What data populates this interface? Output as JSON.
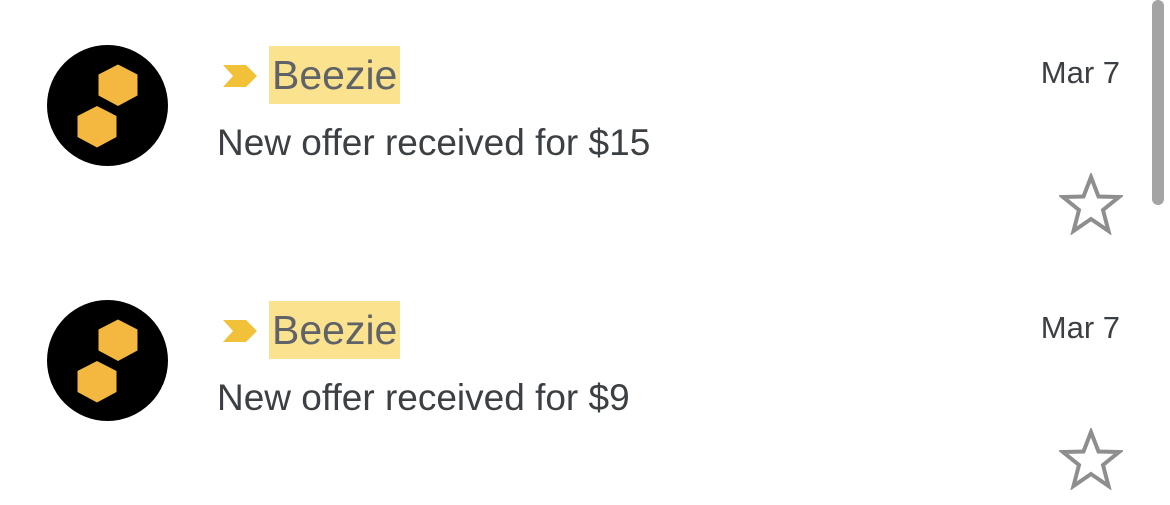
{
  "colors": {
    "avatar_background": "#000000",
    "hexagon": "#f4b73f",
    "importance_marker": "#f2c13a",
    "sender_highlight": "#fbe28f",
    "star_outline": "#8e8e8e"
  },
  "icons": {
    "avatar": "beezie-honeycomb-logo",
    "importance": "importance-marker-icon",
    "star": "star-outline-icon"
  },
  "messages": [
    {
      "sender": "Beezie",
      "subject": "New offer received for $15",
      "date": "Mar 7",
      "starred": false,
      "important": true
    },
    {
      "sender": "Beezie",
      "subject": "New offer received for $9",
      "date": "Mar 7",
      "starred": false,
      "important": true
    }
  ]
}
